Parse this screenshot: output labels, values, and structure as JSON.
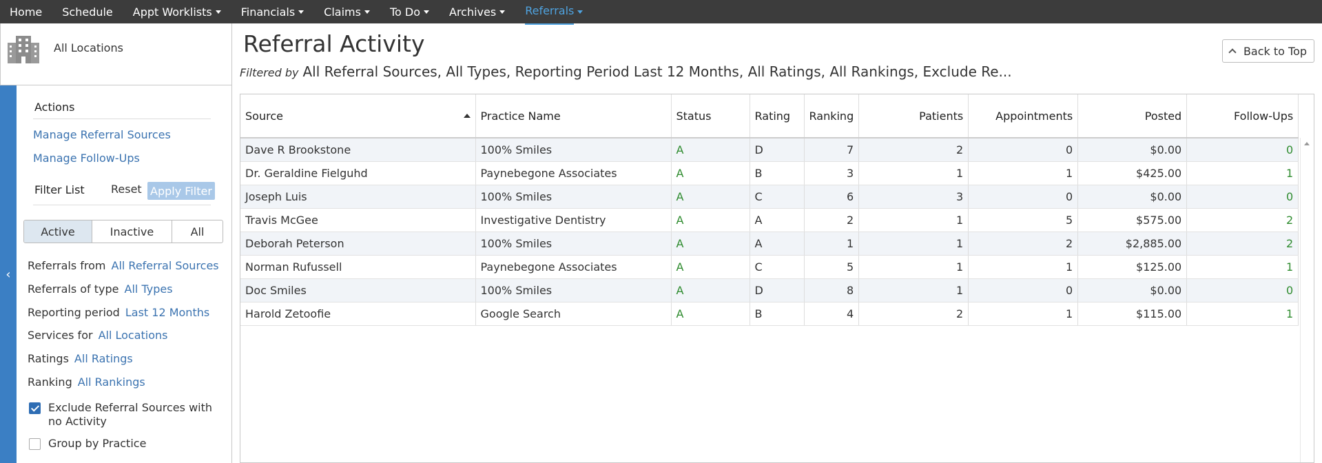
{
  "nav": {
    "items": [
      {
        "label": "Home",
        "dropdown": false,
        "active": false
      },
      {
        "label": "Schedule",
        "dropdown": false,
        "active": false
      },
      {
        "label": "Appt Worklists",
        "dropdown": true,
        "active": false
      },
      {
        "label": "Financials",
        "dropdown": true,
        "active": false
      },
      {
        "label": "Claims",
        "dropdown": true,
        "active": false
      },
      {
        "label": "To Do",
        "dropdown": true,
        "active": false
      },
      {
        "label": "Archives",
        "dropdown": true,
        "active": false
      },
      {
        "label": "Referrals",
        "dropdown": true,
        "active": true
      }
    ]
  },
  "location": {
    "label": "All Locations",
    "icon": "building-icon"
  },
  "sidebar": {
    "actions_heading": "Actions",
    "links": [
      "Manage Referral Sources",
      "Manage Follow-Ups"
    ],
    "filter_list_label": "Filter List",
    "reset_label": "Reset",
    "apply_label": "Apply Filter",
    "segments": [
      "Active",
      "Inactive",
      "All"
    ],
    "selected_segment": "Active",
    "filters": [
      {
        "label": "Referrals from",
        "value": "All Referral Sources"
      },
      {
        "label": "Referrals of type",
        "value": "All Types"
      },
      {
        "label": "Reporting period",
        "value": "Last 12 Months"
      },
      {
        "label": "Services for",
        "value": "All Locations"
      },
      {
        "label": "Ratings",
        "value": "All Ratings"
      },
      {
        "label": "Ranking",
        "value": "All Rankings"
      }
    ],
    "checkboxes": [
      {
        "label": "Exclude Referral Sources with no Activity",
        "checked": true
      },
      {
        "label": "Group by Practice",
        "checked": false
      }
    ],
    "collapse_icon": "chevron-left-icon"
  },
  "main": {
    "title": "Referral Activity",
    "filtered_by_label": "Filtered by",
    "filtered_by_text": "All Referral Sources, All Types, Reporting Period Last 12 Months, All Ratings, All Rankings, Exclude Re...",
    "back_to_top_label": "Back to Top"
  },
  "table": {
    "columns": [
      "Source",
      "Practice Name",
      "Status",
      "Rating",
      "Ranking",
      "Patients",
      "Appointments",
      "Posted",
      "Follow-Ups"
    ],
    "sort_column": "Source",
    "sort_direction": "ascending",
    "rows": [
      [
        "Dave R Brookstone",
        "100% Smiles",
        "A",
        "D",
        "7",
        "2",
        "0",
        "$0.00",
        "0"
      ],
      [
        "Dr. Geraldine Fielguhd",
        "Paynebegone Associates",
        "A",
        "B",
        "3",
        "1",
        "1",
        "$425.00",
        "1"
      ],
      [
        "Joseph Luis",
        "100% Smiles",
        "A",
        "C",
        "6",
        "3",
        "0",
        "$0.00",
        "0"
      ],
      [
        "Travis McGee",
        "Investigative Dentistry",
        "A",
        "A",
        "2",
        "1",
        "5",
        "$575.00",
        "2"
      ],
      [
        "Deborah Peterson",
        "100% Smiles",
        "A",
        "A",
        "1",
        "1",
        "2",
        "$2,885.00",
        "2"
      ],
      [
        "Norman Rufussell",
        "Paynebegone Associates",
        "A",
        "C",
        "5",
        "1",
        "1",
        "$125.00",
        "1"
      ],
      [
        "Doc Smiles",
        "100% Smiles",
        "A",
        "D",
        "8",
        "1",
        "0",
        "$0.00",
        "0"
      ],
      [
        "Harold Zetoofie",
        "Google Search",
        "A",
        "B",
        "4",
        "2",
        "1",
        "$115.00",
        "1"
      ]
    ]
  },
  "colors": {
    "nav_bg": "#3c3c3c",
    "accent": "#3b7fc4",
    "link": "#3b73b0",
    "status_green": "#2e8b2e"
  }
}
